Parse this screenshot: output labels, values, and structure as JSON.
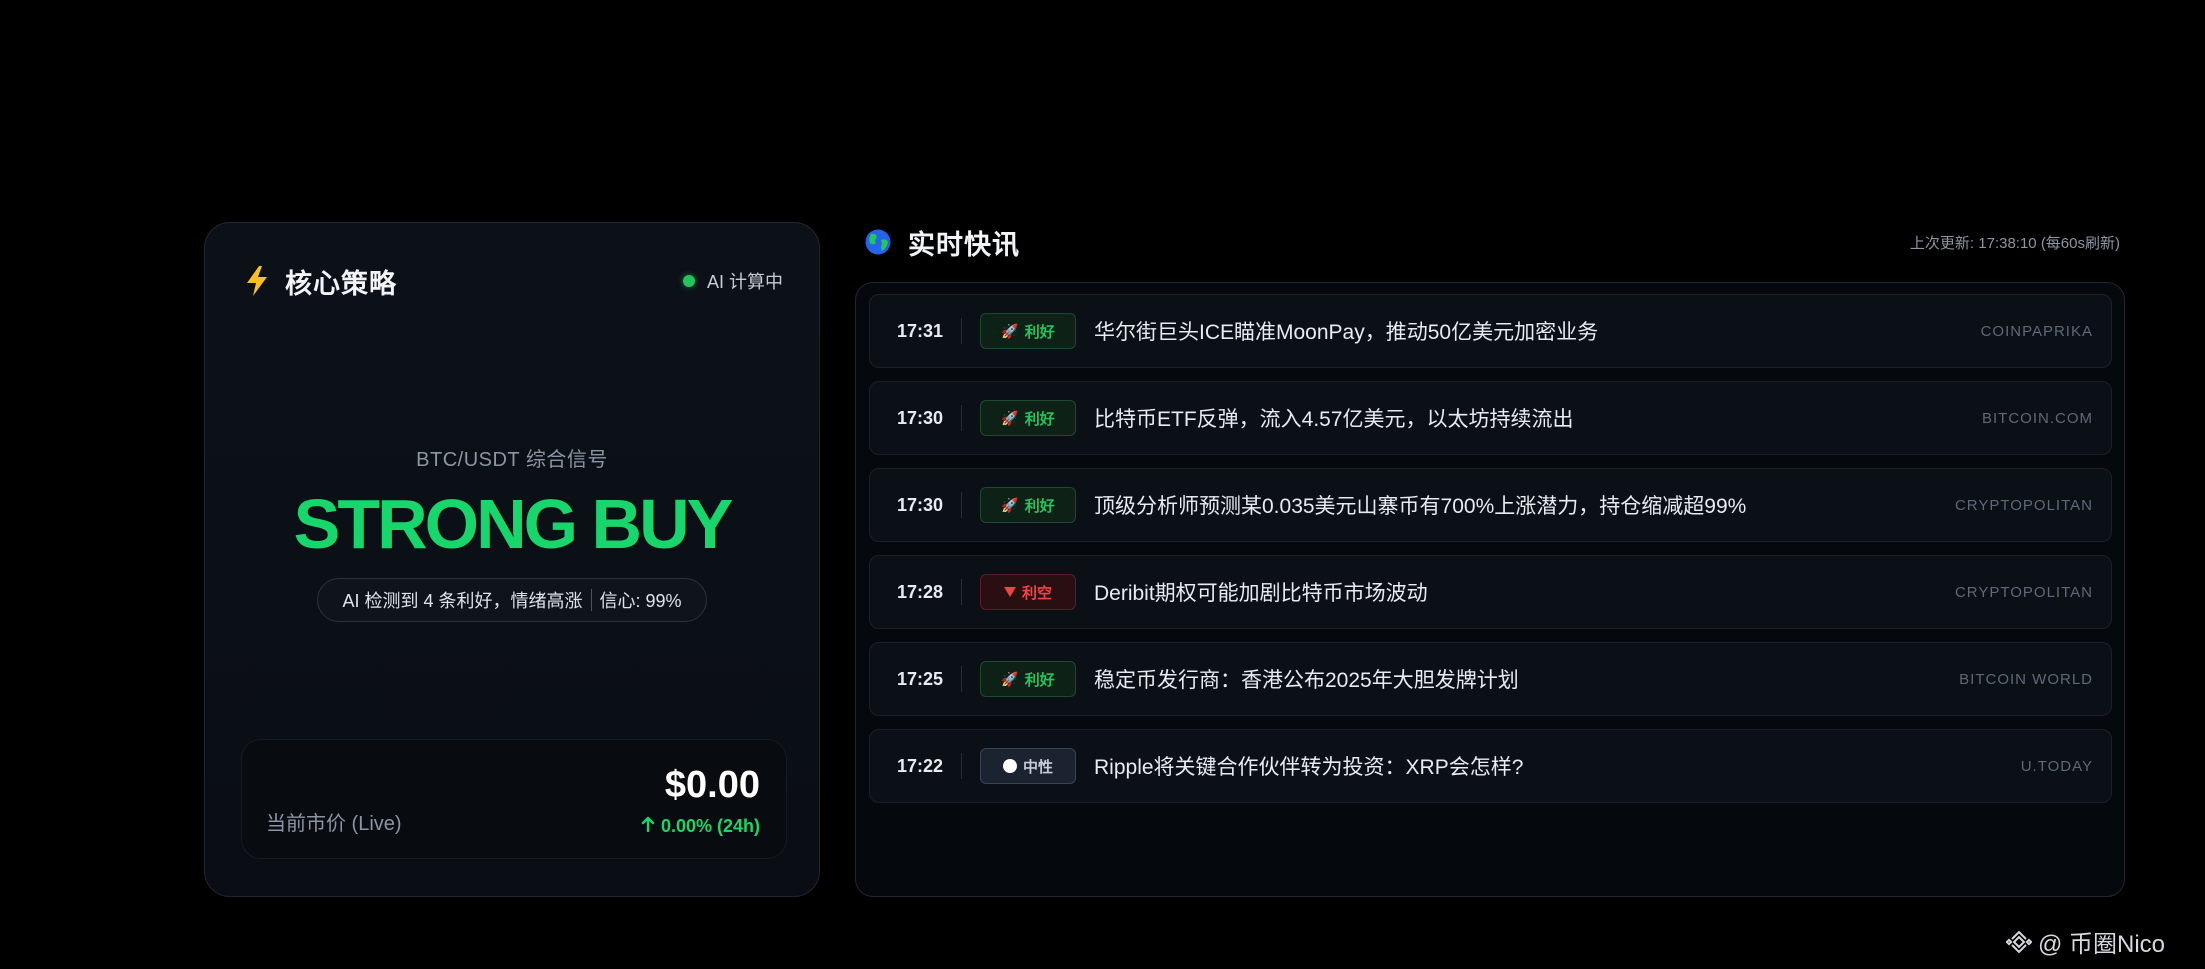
{
  "strategy": {
    "title": "核心策略",
    "icon": "lightning-icon",
    "status_text": "AI 计算中",
    "status_color": "#22c55e",
    "signal_subtitle": "BTC/USDT 综合信号",
    "signal": "STRONG BUY",
    "signal_color": "#17d66b",
    "pill_detection": "AI 检测到 4 条利好，情绪高涨",
    "pill_confidence": "信心: 99%",
    "price_label": "当前市价 (Live)",
    "price_value": "$0.00",
    "price_change": "0.00% (24h)"
  },
  "news": {
    "title": "实时快讯",
    "icon": "globe-icon",
    "last_update": "上次更新: 17:38:10 (每60s刷新)",
    "items": [
      {
        "time": "17:31",
        "sentiment": "bullish",
        "badge": "利好",
        "headline": "华尔街巨头ICE瞄准MoonPay，推动50亿美元加密业务",
        "source": "COINPAPRIKA"
      },
      {
        "time": "17:30",
        "sentiment": "bullish",
        "badge": "利好",
        "headline": "比特币ETF反弹，流入4.57亿美元，以太坊持续流出",
        "source": "BITCOIN.COM"
      },
      {
        "time": "17:30",
        "sentiment": "bullish",
        "badge": "利好",
        "headline": "顶级分析师预测某0.035美元山寨币有700%上涨潜力，持仓缩减超99%",
        "source": "CRYPTOPOLITAN"
      },
      {
        "time": "17:28",
        "sentiment": "bearish",
        "badge": "利空",
        "headline": "Deribit期权可能加剧比特币市场波动",
        "source": "CRYPTOPOLITAN"
      },
      {
        "time": "17:25",
        "sentiment": "bullish",
        "badge": "利好",
        "headline": "稳定币发行商：香港公布2025年大胆发牌计划",
        "source": "BITCOIN WORLD"
      },
      {
        "time": "17:22",
        "sentiment": "neutral",
        "badge": "中性",
        "headline": "Ripple将关键合作伙伴转为投资：XRP会怎样?",
        "source": "U.TODAY"
      }
    ]
  },
  "watermark": {
    "text": "@ 币圈Nico",
    "icon": "binance-icon"
  }
}
